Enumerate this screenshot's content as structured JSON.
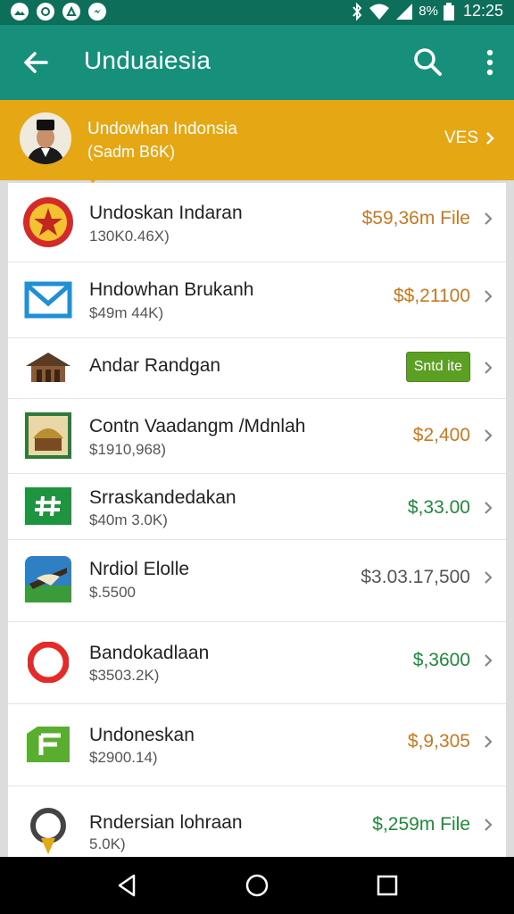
{
  "status_bar": {
    "battery_percent": "8%",
    "time": "12:25",
    "icons": [
      "gallery-notification-icon",
      "app-notification-icon",
      "photos-notification-icon",
      "messenger-notification-icon",
      "bluetooth-icon",
      "wifi-icon",
      "signal-icon",
      "battery-icon"
    ]
  },
  "app_bar": {
    "title": "Unduaiesia"
  },
  "banner": {
    "title": "Undowhan Indonsia",
    "subtitle": "(Sadm B6K)",
    "action": "VES"
  },
  "list": {
    "items": [
      {
        "title": "Undoskan Indaran",
        "subtitle": "130K0.46X)",
        "price": "$59,36m File",
        "price_color": "#c8781e",
        "icon": "emblem-icon"
      },
      {
        "title": "Hndowhan Brukanh",
        "subtitle": "$49m 44K)",
        "price": "$$,21100",
        "price_color": "#c8781e",
        "icon": "mail-icon"
      },
      {
        "title": "Andar Randgan",
        "badge": "Sntd ite",
        "badge_color": "#5ca023",
        "icon": "house-icon"
      },
      {
        "title": "Contn Vaadangm /Mdnlah",
        "subtitle": "$1910,968)",
        "price": "$2,400",
        "price_color": "#c8781e",
        "icon": "landmark-icon"
      },
      {
        "title": "Srraskandedakan",
        "subtitle": "$40m 3.0K)",
        "price": "$,33.00",
        "price_color": "#1e8a3a",
        "icon": "hashtag-icon"
      },
      {
        "title": "Nrdiol Elolle",
        "subtitle": "$.5500",
        "price": "$3.03.17,500",
        "price_color": "#555555",
        "icon": "boat-icon"
      },
      {
        "title": "Bandokadlaan",
        "subtitle": "$3503.2K)",
        "price": "$,3600",
        "price_color": "#1e8a3a",
        "icon": "record-icon"
      },
      {
        "title": "Undoneskan",
        "subtitle": "$2900.14)",
        "price": "$,9,305",
        "price_color": "#c8781e",
        "icon": "folder-icon"
      },
      {
        "title": "Rndersian lohraan",
        "subtitle": "5.0K)",
        "price": "$,259m File",
        "price_color": "#1e8a3a",
        "icon": "bulb-icon"
      }
    ]
  },
  "colors": {
    "status_bar": "#0d6e5a",
    "app_bar": "#16907a",
    "banner": "#e6a714",
    "nav_bar": "#000000"
  }
}
